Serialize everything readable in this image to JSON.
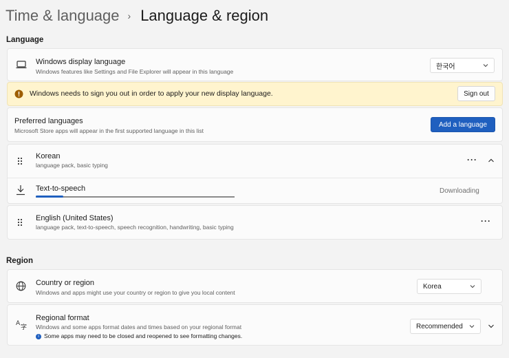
{
  "breadcrumb": {
    "parent": "Time & language",
    "separator": "›",
    "current": "Language & region"
  },
  "language_section": {
    "heading": "Language",
    "display_language": {
      "title": "Windows display language",
      "subtitle": "Windows features like Settings and File Explorer will appear in this language",
      "selected": "한국어"
    },
    "sign_out_notice": {
      "message": "Windows needs to sign you out in order to apply your new display language.",
      "button": "Sign out"
    },
    "preferred": {
      "title": "Preferred languages",
      "subtitle": "Microsoft Store apps will appear in the first supported language in this list",
      "button": "Add a language"
    },
    "korean": {
      "title": "Korean",
      "subtitle": "language pack, basic typing",
      "tts_title": "Text-to-speech",
      "tts_status": "Downloading",
      "tts_progress": 0.14
    },
    "english": {
      "title": "English (United States)",
      "subtitle": "language pack, text-to-speech, speech recognition, handwriting, basic typing"
    }
  },
  "region_section": {
    "heading": "Region",
    "country": {
      "title": "Country or region",
      "subtitle": "Windows and apps might use your country or region to give you local content",
      "selected": "Korea"
    },
    "format": {
      "title": "Regional format",
      "subtitle": "Windows and some apps format dates and times based on your regional format",
      "note": "Some apps may need to be closed and reopened to see formatting changes.",
      "selected": "Recommended"
    }
  },
  "colors": {
    "accent": "#1f5fbf",
    "warning_bg": "#fff4ce",
    "warning_icon": "#9d5d00"
  }
}
